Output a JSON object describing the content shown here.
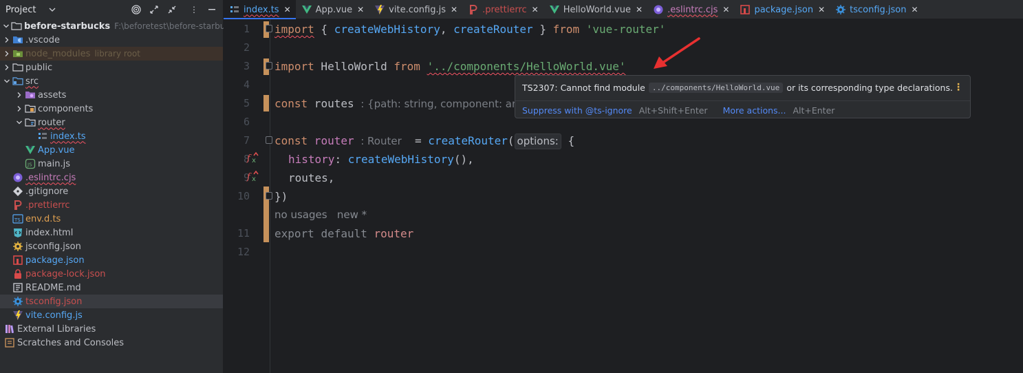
{
  "project_panel": {
    "title": "Project",
    "tree": [
      {
        "label": "before-starbucks",
        "hint": "F:\\beforetest\\before-starbucks",
        "icon": "folder-icon",
        "level": 0,
        "chev": "down",
        "color": "#dfe1e5",
        "bold": true
      },
      {
        "label": ".vscode",
        "hint": "",
        "icon": "folder-vscode-icon",
        "level": 0,
        "chev": "right",
        "color": "#bcbec4"
      },
      {
        "label": "node_modules",
        "hint": "library root",
        "icon": "folder-nodemodules-icon",
        "level": 0,
        "chev": "right",
        "color": "#6b5e48",
        "hint_color": "#6b5e48",
        "highlight": "nm"
      },
      {
        "label": "public",
        "hint": "",
        "icon": "folder-icon",
        "level": 0,
        "chev": "right",
        "color": "#bcbec4"
      },
      {
        "label": "src",
        "hint": "",
        "icon": "folder-src-icon",
        "level": 0,
        "chev": "down",
        "color": "#bcbec4",
        "squiggle": true
      },
      {
        "label": "assets",
        "hint": "",
        "icon": "folder-assets-icon",
        "level": 1,
        "chev": "right",
        "color": "#bcbec4"
      },
      {
        "label": "components",
        "hint": "",
        "icon": "folder-components-icon",
        "level": 1,
        "chev": "right",
        "color": "#bcbec4"
      },
      {
        "label": "router",
        "hint": "",
        "icon": "folder-router-icon",
        "level": 1,
        "chev": "down",
        "color": "#bcbec4",
        "squiggle": true
      },
      {
        "label": "index.ts",
        "hint": "",
        "icon": "router-file-icon",
        "level": 2,
        "chev": "",
        "color": "#56a8f5",
        "squiggle": true
      },
      {
        "label": "App.vue",
        "hint": "",
        "icon": "vue-icon",
        "level": 1,
        "chev": "",
        "color": "#56a8f5"
      },
      {
        "label": "main.js",
        "hint": "",
        "icon": "js-icon",
        "level": 1,
        "chev": "",
        "color": "#bcbec4"
      },
      {
        "label": ".eslintrc.cjs",
        "hint": "",
        "icon": "eslint-icon",
        "level": 0,
        "chev": "",
        "color": "#c77dbb",
        "squiggle": true
      },
      {
        "label": ".gitignore",
        "hint": "",
        "icon": "git-icon",
        "level": 0,
        "chev": "",
        "color": "#bcbec4"
      },
      {
        "label": ".prettierrc",
        "hint": "",
        "icon": "prettier-icon",
        "level": 0,
        "chev": "",
        "color": "#c94f4f"
      },
      {
        "label": "env.d.ts",
        "hint": "",
        "icon": "ts-icon",
        "level": 0,
        "chev": "",
        "color": "#e0a050"
      },
      {
        "label": "index.html",
        "hint": "",
        "icon": "html-icon",
        "level": 0,
        "chev": "",
        "color": "#bcbec4"
      },
      {
        "label": "jsconfig.json",
        "hint": "",
        "icon": "jsconfig-icon",
        "level": 0,
        "chev": "",
        "color": "#bcbec4"
      },
      {
        "label": "package.json",
        "hint": "",
        "icon": "npm-icon",
        "level": 0,
        "chev": "",
        "color": "#56a8f5"
      },
      {
        "label": "package-lock.json",
        "hint": "",
        "icon": "lock-icon",
        "level": 0,
        "chev": "",
        "color": "#c94f4f"
      },
      {
        "label": "README.md",
        "hint": "",
        "icon": "markdown-icon",
        "level": 0,
        "chev": "",
        "color": "#bcbec4"
      },
      {
        "label": "tsconfig.json",
        "hint": "",
        "icon": "tsconfig-icon",
        "level": 0,
        "chev": "",
        "color": "#c94f4f",
        "highlight": "sel"
      },
      {
        "label": "vite.config.js",
        "hint": "",
        "icon": "vite-icon",
        "level": 0,
        "chev": "",
        "color": "#56a8f5"
      },
      {
        "label": "External Libraries",
        "hint": "",
        "icon": "library-icon",
        "level": -1,
        "chev": "right",
        "color": "#bcbec4"
      },
      {
        "label": "Scratches and Consoles",
        "hint": "",
        "icon": "scratches-icon",
        "level": -1,
        "chev": "",
        "color": "#bcbec4"
      }
    ]
  },
  "tabs": [
    {
      "label": "index.ts",
      "icon": "router-file-icon",
      "color": "#56a8f5",
      "active": true,
      "squiggle": true
    },
    {
      "label": "App.vue",
      "icon": "vue-icon",
      "color": "#bcbec4"
    },
    {
      "label": "vite.config.js",
      "icon": "vite-icon",
      "color": "#bcbec4"
    },
    {
      "label": ".prettierrc",
      "icon": "prettier-icon",
      "color": "#c94f4f"
    },
    {
      "label": "HelloWorld.vue",
      "icon": "vue-icon",
      "color": "#bcbec4"
    },
    {
      "label": ".eslintrc.cjs",
      "icon": "eslint-icon",
      "color": "#c77dbb",
      "squiggle": true
    },
    {
      "label": "package.json",
      "icon": "npm-icon",
      "color": "#56a8f5"
    },
    {
      "label": "tsconfig.json",
      "icon": "tsconfig-icon",
      "color": "#56a8f5"
    }
  ],
  "editor": {
    "line_numbers": [
      "1",
      "2",
      "3",
      "4",
      "5",
      "6",
      "7",
      "8",
      "9",
      "10",
      "11",
      "12"
    ],
    "line1": {
      "kw1": "import",
      "p1": " { ",
      "f1": "createWebHistory",
      "p2": ", ",
      "f2": "createRouter",
      "p3": " } ",
      "kw2": "from",
      "p4": " ",
      "str": "'vue-router'"
    },
    "line3": {
      "kw1": "import",
      "p1": " HelloWorld ",
      "kw2": "from",
      "p2": " ",
      "str": "'../components/HelloWorld.vue'"
    },
    "line5": {
      "kw": "const",
      "var": " routes ",
      "hint": ": {path: string, component: an"
    },
    "line7": {
      "kw": "const",
      "var": " router ",
      "hint": ": Router",
      "p1": "  = ",
      "fn": "createRouter",
      "p2": "(",
      "param": "options:",
      "p3": " {"
    },
    "line8": {
      "field": "history",
      "p1": ": ",
      "fn": "createWebHistory",
      "p2": "(),"
    },
    "line9": {
      "text": "routes,"
    },
    "line10": {
      "text": "})"
    },
    "lens": {
      "usages": "no usages",
      "author": "new *"
    },
    "line11": {
      "kw1": "export",
      "kw2": "default",
      "var": "router"
    },
    "colors": {
      "keyword": "#cf8e6d",
      "function": "#56a8f5",
      "string": "#6aab73",
      "error": "#f75464",
      "vcs_modified": "#c6915b"
    }
  },
  "popup": {
    "error_code": "TS2307: Cannot find module",
    "module_path": "../components/HelloWorld.vue",
    "error_tail": "or its corresponding type declarations.",
    "action1": "Suppress with @ts-ignore",
    "action1_shortcut": "Alt+Shift+Enter",
    "action2": "More actions...",
    "action2_shortcut": "Alt+Enter",
    "more_icon": "kebab-menu-icon"
  }
}
